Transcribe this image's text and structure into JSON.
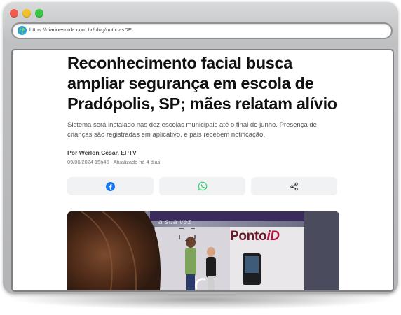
{
  "browser": {
    "url": "https://diarioescola.com.br/blog/noticiasDE"
  },
  "article": {
    "headline": "Reconhecimento facial busca ampliar segurança em escola de Pradópolis, SP; mães relatam alívio",
    "summary": "Sistema será instalado nas dez escolas municipais até o final de junho. Presença de crianças são registradas em aplicativo, e pais recebem notificação.",
    "author": "Por Werlon César, EPTV",
    "meta": "09/06/2024 15h45 · Atualizado há 4 dias"
  },
  "share": {
    "icons": [
      "facebook-icon",
      "whatsapp-icon",
      "share-icon"
    ],
    "colors": {
      "facebook": "#1877f2",
      "whatsapp": "#25d366",
      "share": "#333333"
    }
  },
  "photo": {
    "banner_text": "a sua vez",
    "brand_prefix": "Ponto",
    "brand_suffix": "iD"
  }
}
